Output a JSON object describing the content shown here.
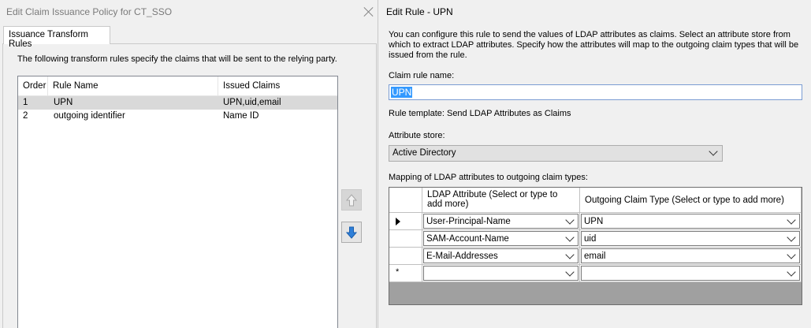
{
  "left": {
    "title": "Edit Claim Issuance Policy for CT_SSO",
    "tab": "Issuance Transform Rules",
    "description": "The following transform rules specify the claims that will be sent to the relying party.",
    "columns": {
      "order": "Order",
      "name": "Rule Name",
      "claims": "Issued Claims"
    },
    "rules": [
      {
        "order": "1",
        "name": "UPN",
        "claims": "UPN,uid,email",
        "selected": true
      },
      {
        "order": "2",
        "name": "outgoing identifier",
        "claims": "Name ID",
        "selected": false
      }
    ]
  },
  "right": {
    "title": "Edit Rule - UPN",
    "intro": "You can configure this rule to send the values of LDAP attributes as claims. Select an attribute store from which to extract LDAP attributes. Specify how the attributes will map to the outgoing claim types that will be issued from the rule.",
    "rule_name_label": "Claim rule name:",
    "rule_name_value": "UPN",
    "template_text": "Rule template: Send LDAP Attributes as Claims",
    "store_label": "Attribute store:",
    "store_value": "Active Directory",
    "mapping_label": "Mapping of LDAP attributes to outgoing claim types:",
    "mapping_headers": {
      "ldap": "LDAP Attribute (Select or type to add more)",
      "claim": "Outgoing Claim Type (Select or type to add more)"
    },
    "mappings": [
      {
        "ldap": "User-Principal-Name",
        "claim": "UPN"
      },
      {
        "ldap": "SAM-Account-Name",
        "claim": "uid"
      },
      {
        "ldap": "E-Mail-Addresses",
        "claim": "email"
      },
      {
        "ldap": "",
        "claim": ""
      }
    ],
    "new_row_marker": "*"
  }
}
